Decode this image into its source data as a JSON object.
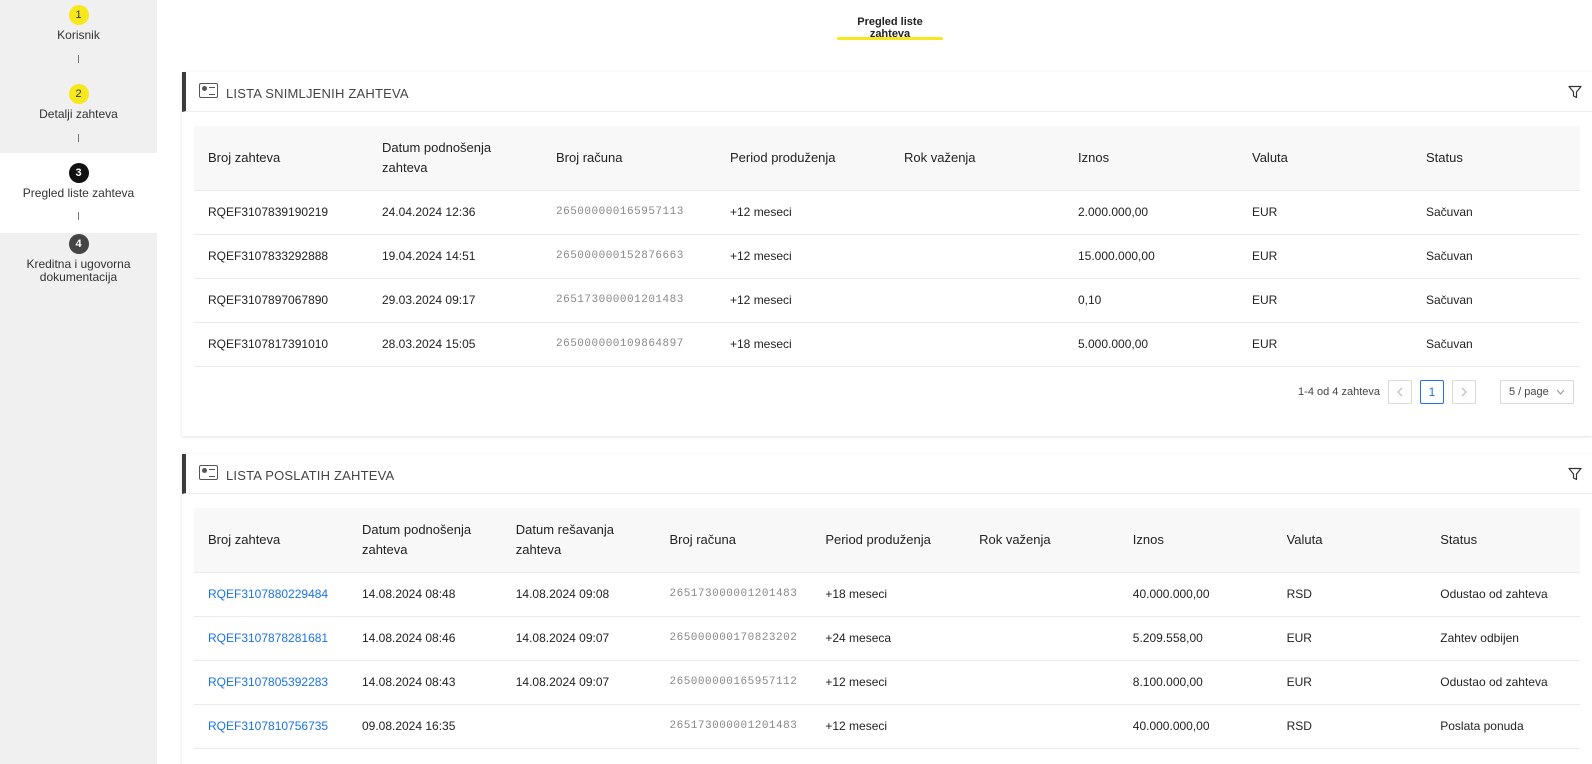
{
  "sidebar": {
    "steps": [
      {
        "number": "1",
        "label": "Korisnik"
      },
      {
        "number": "2",
        "label": "Detalji zahteva"
      },
      {
        "number": "3",
        "label": "Pregled liste zahteva"
      },
      {
        "number": "4",
        "label": "Kreditna i ugovorna dokumentacija"
      }
    ]
  },
  "top_tab": {
    "label": "Pregled liste zahteva"
  },
  "saved": {
    "title": "LISTA SNIMLJENIH ZAHTEVA",
    "headers": [
      "Broj zahteva",
      "Datum podnošenja zahteva",
      "Broj računa",
      "Period produženja",
      "Rok važenja",
      "Iznos",
      "Valuta",
      "Status"
    ],
    "rows": [
      [
        "RQEF3107839190219",
        "24.04.2024 12:36",
        "265000000165957113",
        "+12 meseci",
        "",
        "2.000.000,00",
        "EUR",
        "Sačuvan"
      ],
      [
        "RQEF3107833292888",
        "19.04.2024 14:51",
        "265000000152876663",
        "+12 meseci",
        "",
        "15.000.000,00",
        "EUR",
        "Sačuvan"
      ],
      [
        "RQEF3107897067890",
        "29.03.2024 09:17",
        "265173000001201483",
        "+12 meseci",
        "",
        "0,10",
        "EUR",
        "Sačuvan"
      ],
      [
        "RQEF3107817391010",
        "28.03.2024 15:05",
        "265000000109864897",
        "+18 meseci",
        "",
        "5.000.000,00",
        "EUR",
        "Sačuvan"
      ]
    ],
    "pagination": {
      "summary": "1-4 od 4 zahteva",
      "page": "1",
      "per_page": "5 / page"
    }
  },
  "sent": {
    "title": "LISTA POSLATIH ZAHTEVA",
    "headers": [
      "Broj zahteva",
      "Datum podnošenja zahteva",
      "Datum rešavanja zahteva",
      "Broj računa",
      "Period produženja",
      "Rok važenja",
      "Iznos",
      "Valuta",
      "Status"
    ],
    "rows": [
      [
        "RQEF3107880229484",
        "14.08.2024 08:48",
        "14.08.2024 09:08",
        "265173000001201483",
        "+18 meseci",
        "",
        "40.000.000,00",
        "RSD",
        "Odustao od zahteva"
      ],
      [
        "RQEF3107878281681",
        "14.08.2024 08:46",
        "14.08.2024 09:07",
        "265000000170823202",
        "+24 meseca",
        "",
        "5.209.558,00",
        "EUR",
        "Zahtev odbijen"
      ],
      [
        "RQEF3107805392283",
        "14.08.2024 08:43",
        "14.08.2024 09:07",
        "265000000165957112",
        "+12 meseci",
        "",
        "8.100.000,00",
        "EUR",
        "Odustao od zahteva"
      ],
      [
        "RQEF3107810756735",
        "09.08.2024 16:35",
        "",
        "265173000001201483",
        "+12 meseci",
        "",
        "40.000.000,00",
        "RSD",
        "Poslata ponuda"
      ]
    ]
  },
  "colors": {
    "accent_yellow": "#f6e81c",
    "link_blue": "#1a73e8",
    "sidebar_bg": "#f0f0f0"
  }
}
